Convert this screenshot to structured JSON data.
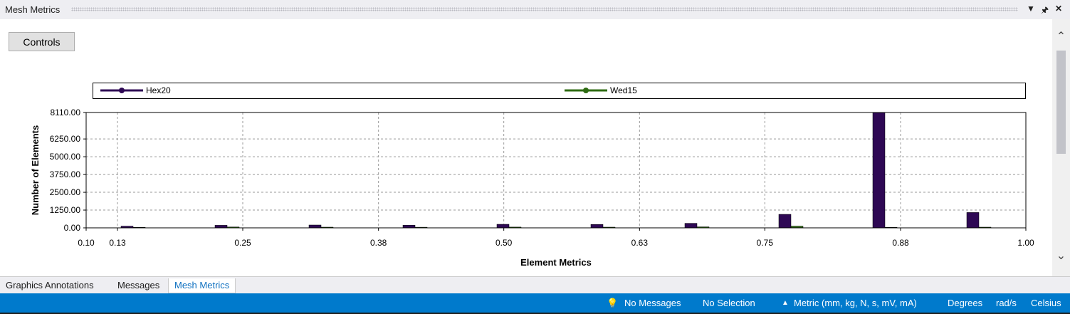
{
  "panel": {
    "title": "Mesh Metrics",
    "dropdown_icon": "chevron-down-icon",
    "pin_icon": "pin-icon",
    "close_icon": "close-icon"
  },
  "controls_button": {
    "label": "Controls"
  },
  "chart_data": {
    "type": "bar",
    "title": "",
    "xlabel": "Element Metrics",
    "ylabel": "Number of Elements",
    "xlim": [
      0.1,
      1.0
    ],
    "ylim": [
      0,
      8110
    ],
    "x_ticks": [
      "0.10",
      "0.13",
      "0.25",
      "0.38",
      "0.50",
      "0.63",
      "0.75",
      "0.88",
      "1.00"
    ],
    "x_tick_values": [
      0.1,
      0.13,
      0.25,
      0.38,
      0.5,
      0.63,
      0.75,
      0.88,
      1.0
    ],
    "y_ticks": [
      "0.00",
      "1250.00",
      "2500.00",
      "3750.00",
      "5000.00",
      "6250.00",
      "8110.00"
    ],
    "y_tick_values": [
      0,
      1250,
      2500,
      3750,
      5000,
      6250,
      8110
    ],
    "grid": true,
    "legend_position": "top",
    "x": [
      0.145,
      0.235,
      0.325,
      0.415,
      0.505,
      0.595,
      0.685,
      0.775,
      0.865,
      0.955
    ],
    "series": [
      {
        "name": "Hex20",
        "color": "#2e0854",
        "values": [
          120,
          180,
          200,
          190,
          250,
          240,
          320,
          950,
          8110,
          1080
        ]
      },
      {
        "name": "Wed15",
        "color": "#2e6b12",
        "values": [
          40,
          60,
          50,
          45,
          55,
          50,
          70,
          120,
          40,
          50
        ]
      }
    ]
  },
  "tabs": [
    {
      "label": "Graphics Annotations",
      "active": false
    },
    {
      "label": "Messages",
      "active": false
    },
    {
      "label": "Mesh Metrics",
      "active": true
    }
  ],
  "status": {
    "messages": "No Messages",
    "messages_icon": "lightbulb-icon",
    "selection": "No Selection",
    "units": "Metric (mm, kg, N, s, mV, mA)",
    "units_icon": "caret-up-icon",
    "angle": "Degrees",
    "angular_velocity": "rad/s",
    "temperature": "Celsius"
  },
  "colors": {
    "accent": "#007acc",
    "hex20": "#2e0854",
    "wed15": "#2e6b12"
  }
}
